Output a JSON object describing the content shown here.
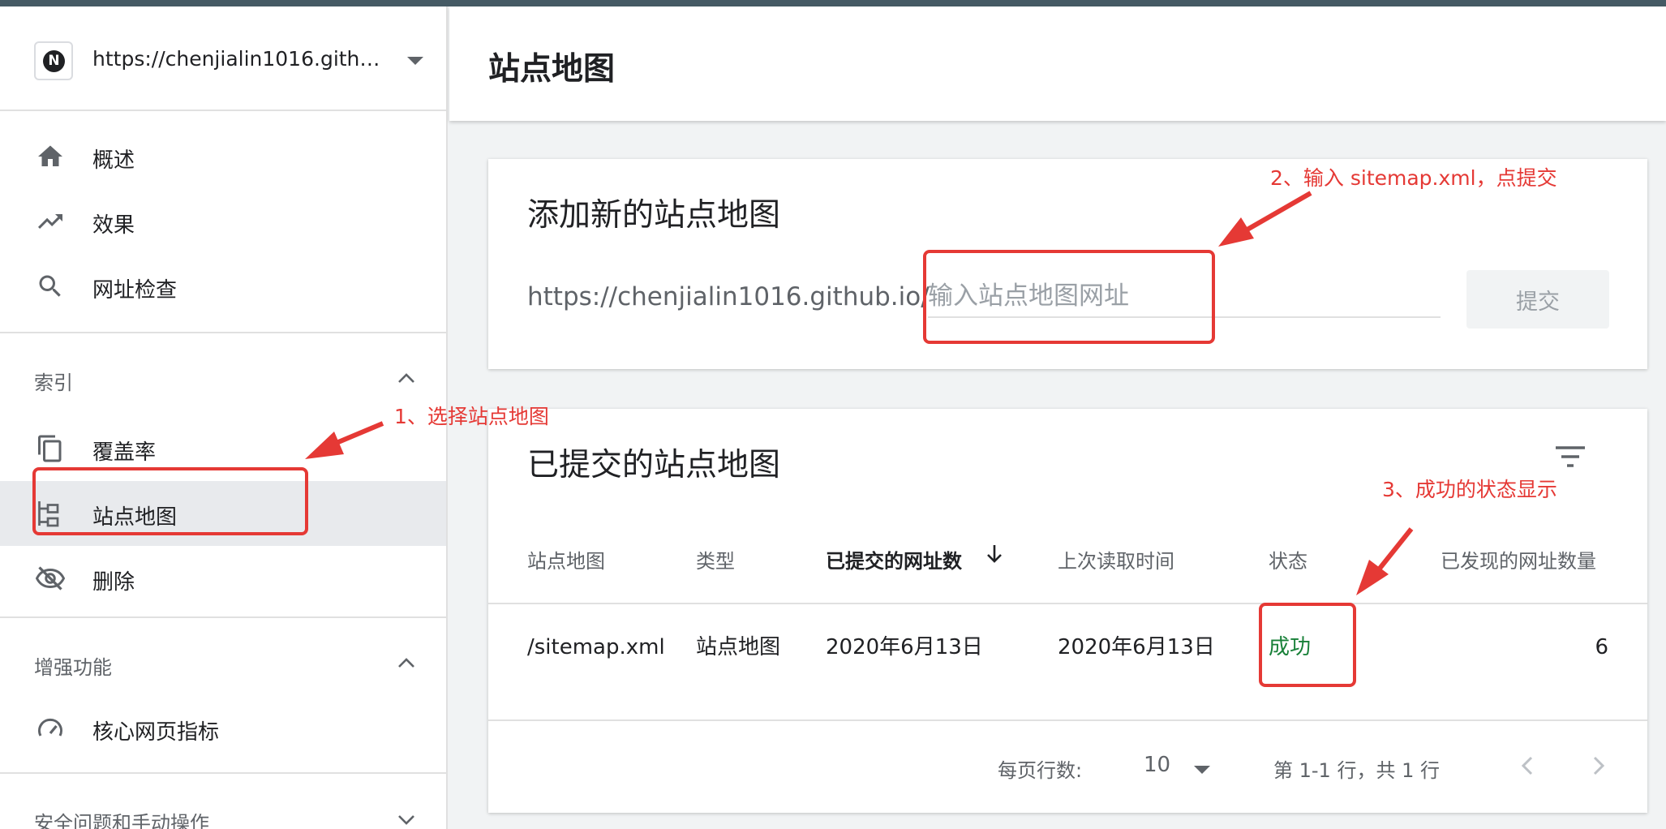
{
  "property": {
    "url": "https://chenjialin1016.github.io/",
    "logo_letter": "N"
  },
  "sidebar": {
    "items": [
      {
        "label": "概述",
        "icon": "home-icon"
      },
      {
        "label": "效果",
        "icon": "trending-up-icon"
      },
      {
        "label": "网址检查",
        "icon": "search-icon"
      }
    ],
    "sections": [
      {
        "title": "索引",
        "items": [
          {
            "label": "覆盖率",
            "icon": "copy-icon"
          },
          {
            "label": "站点地图",
            "icon": "sitemap-icon",
            "active": true
          },
          {
            "label": "删除",
            "icon": "eye-off-icon"
          }
        ]
      },
      {
        "title": "增强功能",
        "items": [
          {
            "label": "核心网页指标",
            "icon": "gauge-icon"
          }
        ]
      },
      {
        "title": "安全问题和手动操作",
        "items": []
      }
    ]
  },
  "header": {
    "title": "站点地图"
  },
  "add_card": {
    "title": "添加新的站点地图",
    "prefix": "https://chenjialin1016.github.io/",
    "placeholder": "输入站点地图网址",
    "submit_label": "提交"
  },
  "submitted_card": {
    "title": "已提交的站点地图",
    "columns": [
      "站点地图",
      "类型",
      "已提交的网址数",
      "上次读取时间",
      "状态",
      "已发现的网址数量"
    ],
    "rows": [
      {
        "sitemap": "/sitemap.xml",
        "type": "站点地图",
        "submitted": "2020年6月13日",
        "last_read": "2020年6月13日",
        "status": "成功",
        "discovered": "6"
      }
    ],
    "pagination": {
      "rows_per_page_label": "每页行数:",
      "rows_per_page": "10",
      "range": "第 1-1 行，共 1 行"
    }
  },
  "annotations": {
    "step1": "1、选择站点地图",
    "step2": "2、输入 sitemap.xml，点提交",
    "step3": "3、成功的状态显示"
  },
  "colors": {
    "accent_red": "#e53935",
    "success_green": "#188038",
    "topbar": "#455a64"
  }
}
